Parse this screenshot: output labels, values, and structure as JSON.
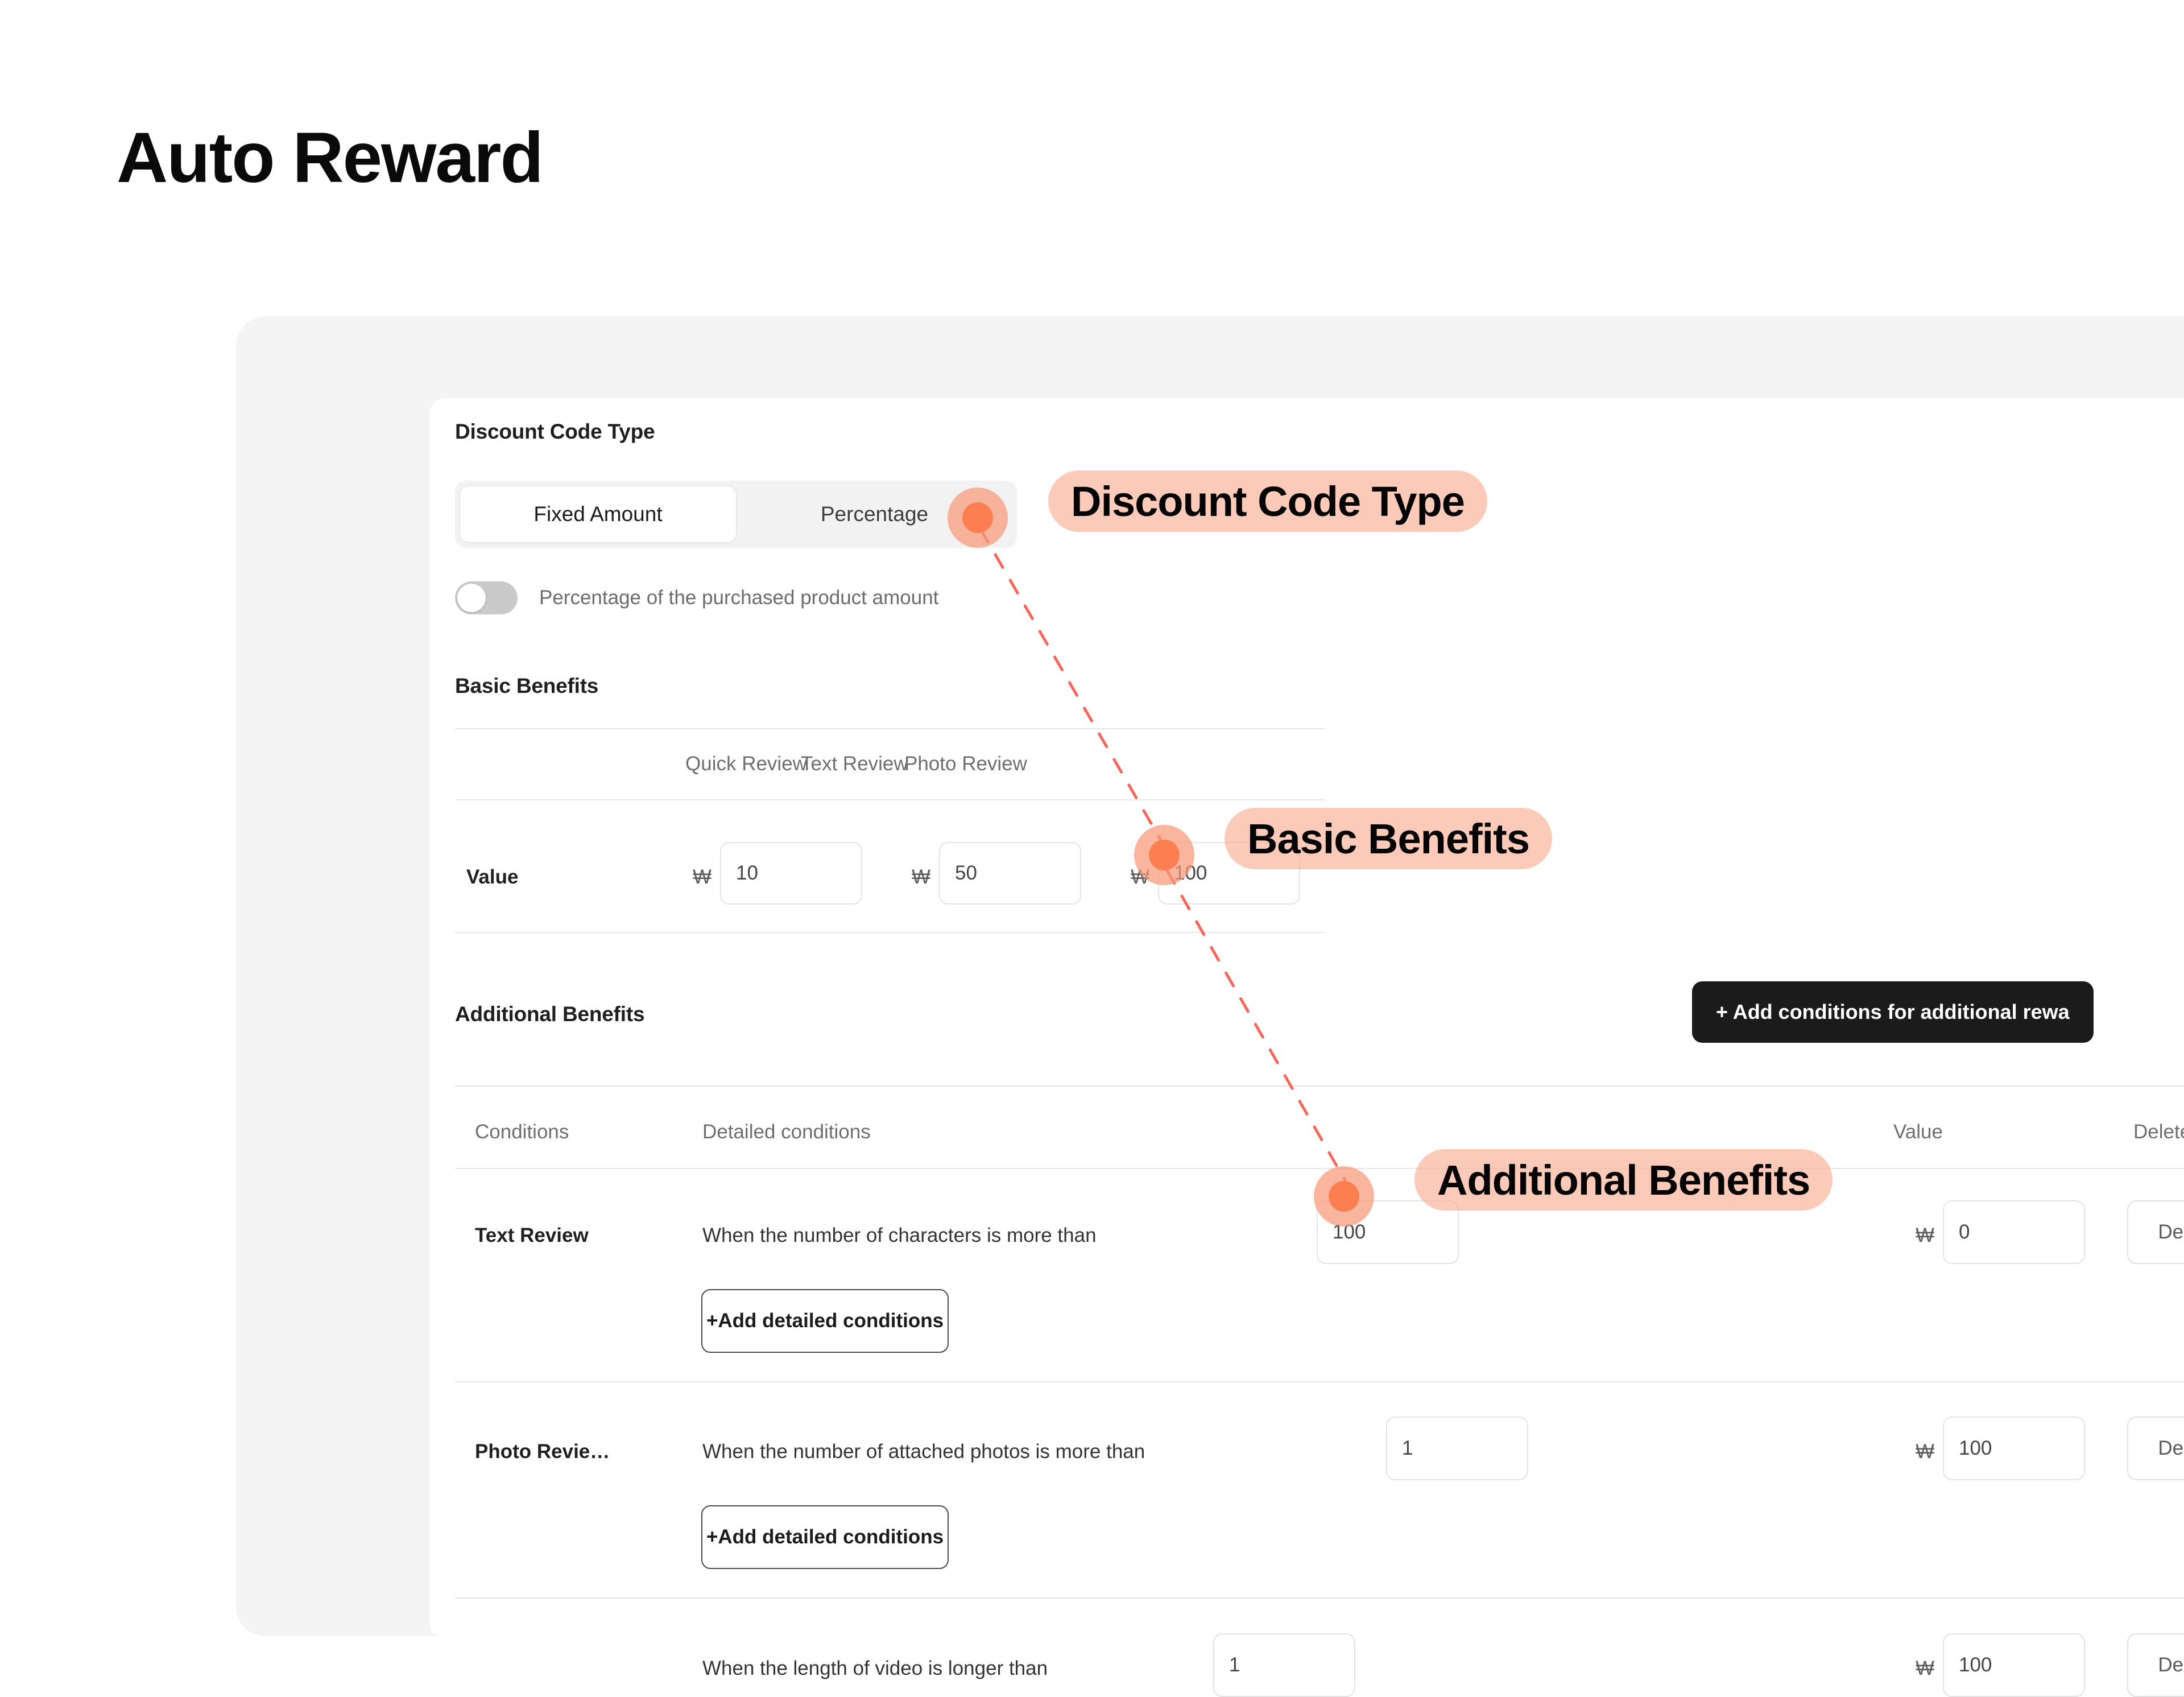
{
  "page": {
    "title": "Auto Reward"
  },
  "discount_code_type": {
    "label": "Discount Code Type",
    "options": [
      "Fixed Amount",
      "Percentage"
    ],
    "selected": "Fixed Amount",
    "toggle_label": "Percentage of the purchased product amount",
    "toggle_on": false
  },
  "basic_benefits": {
    "label": "Basic Benefits",
    "columns": [
      "",
      "Quick Review",
      "Text Review",
      "Photo Review"
    ],
    "rows": [
      {
        "row_label": "Value",
        "cells": [
          {
            "currency": "₩",
            "value": "10"
          },
          {
            "currency": "₩",
            "value": "50"
          },
          {
            "currency": "₩",
            "value": "100"
          }
        ]
      }
    ]
  },
  "additional_benefits": {
    "label": "Additional Benefits",
    "add_button_label": "+ Add conditions for additional rewa",
    "columns": {
      "conditions": "Conditions",
      "detailed_conditions": "Detailed conditions",
      "value": "Value",
      "delete": "Delete"
    },
    "delete_button_label": "Delete",
    "add_detailed_label": "+Add detailed conditions",
    "rows": [
      {
        "condition": "Text Review",
        "detail_text": "When the number of characters is more than",
        "detail_value": "100",
        "currency": "₩",
        "value": "0",
        "has_add_detailed": true
      },
      {
        "condition": "Photo Revie…",
        "detail_text": "When the number of attached photos is more than",
        "detail_value": "1",
        "currency": "₩",
        "value": "100",
        "has_add_detailed": true
      },
      {
        "condition": "",
        "detail_text": "When the length of video is longer than",
        "detail_value": "1",
        "currency": "₩",
        "value": "100",
        "has_add_detailed": false
      }
    ]
  },
  "annotations": {
    "accent_dot_color": "#fb7f50",
    "pill_color": "#faaa8c",
    "connector_color": "#f4675a",
    "items": [
      {
        "label": "Discount Code Type"
      },
      {
        "label": "Basic Benefits"
      },
      {
        "label": "Additional Benefits"
      }
    ]
  }
}
